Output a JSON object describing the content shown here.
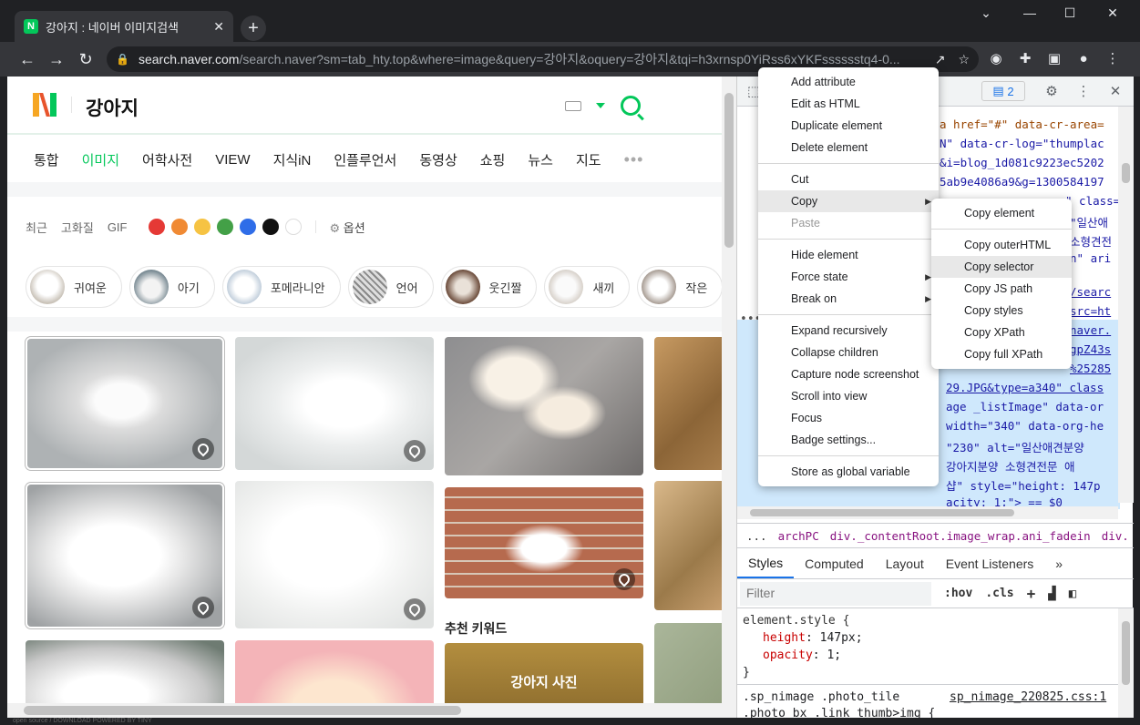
{
  "browser": {
    "tab_title": "강아지 : 네이버 이미지검색",
    "tab_favicon": "N",
    "url_host": "search.naver.com",
    "url_path": "/search.naver?sm=tab_hty.top&where=image&query=강아지&oquery=강아지&tqi=h3xrnsp0YiRss6xYKFsssssstq4-0..."
  },
  "naver": {
    "query": "강아지",
    "tabs": [
      "통합",
      "이미지",
      "어학사전",
      "VIEW",
      "지식iN",
      "인플루언서",
      "동영상",
      "쇼핑",
      "뉴스",
      "지도"
    ],
    "active_tab_index": 1,
    "more": "•••",
    "filters": [
      "최근",
      "고화질",
      "GIF"
    ],
    "colors": [
      "#e53935",
      "#f08a34",
      "#f6c343",
      "#43a047",
      "#2f6de8",
      "#111111",
      "#ffffff"
    ],
    "options_label": "옵션",
    "keyword_chips": [
      "귀여운",
      "아기",
      "포메라니안",
      "언어",
      "웃긴짤",
      "새끼",
      "작은"
    ],
    "recommended_heading": "추천 키워드",
    "recommended_item": "강아지 사진",
    "accent": "#03c75a"
  },
  "devtools": {
    "message_count": "2",
    "element_lines": [
      "a href=\"#\" data-cr-area=",
      "N\" data-cr-log=\"thumplac",
      "&i=blog_1d081c9223ec5202",
      "5ab9e4086a9&g=1300584197",
      "\" class=\"thumb _ima",
      "\"일산애",
      "소형견전",
      "n\" ari"
    ],
    "element_lines_selected": [
      "/searc",
      "src=ht",
      "naver.",
      "gpZ43s",
      "%25285",
      "29.JPG&type=a340\" class",
      "age _listImage\" data-or",
      "width=\"340\" data-org-he",
      "\"230\" alt=\"일산애견분양",
      "강아지분양 소형견전문 애",
      "샵\" style=\"height: 147p",
      "acity: 1;\"> == $0"
    ],
    "breadcrumbs": [
      "...",
      "archPC",
      "div._contentRoot.image_wrap.ani_fadein",
      "div."
    ],
    "style_tabs": [
      "Styles",
      "Computed",
      "Layout",
      "Event Listeners",
      "»"
    ],
    "filter_placeholder": "Filter",
    "hov": ":hov",
    "cls": ".cls",
    "element_style_selector": "element.style {",
    "element_style_props": [
      {
        "name": "height",
        "value": "147px;"
      },
      {
        "name": "opacity",
        "value": "1;"
      }
    ],
    "closing_brace": "}",
    "rule_selector": ".sp_nimage .photo_tile",
    "rule_selector2": ".photo_bx .link_thumb>img {",
    "rule_source": "sp_nimage_220825.css:1"
  },
  "context_menu": {
    "groups": [
      [
        "Add attribute",
        "Edit as HTML",
        "Duplicate element",
        "Delete element"
      ],
      [
        "Cut",
        "Copy",
        "Paste"
      ],
      [
        "Hide element",
        "Force state",
        "Break on"
      ],
      [
        "Expand recursively",
        "Collapse children",
        "Capture node screenshot",
        "Scroll into view",
        "Focus",
        "Badge settings..."
      ],
      [
        "Store as global variable"
      ]
    ]
  },
  "copy_submenu": {
    "groups": [
      [
        "Copy element"
      ],
      [
        "Copy outerHTML",
        "Copy selector",
        "Copy JS path",
        "Copy styles",
        "Copy XPath",
        "Copy full XPath"
      ]
    ]
  },
  "footer_text": "open source / DOWNLOAD    POWERED BY TINY"
}
